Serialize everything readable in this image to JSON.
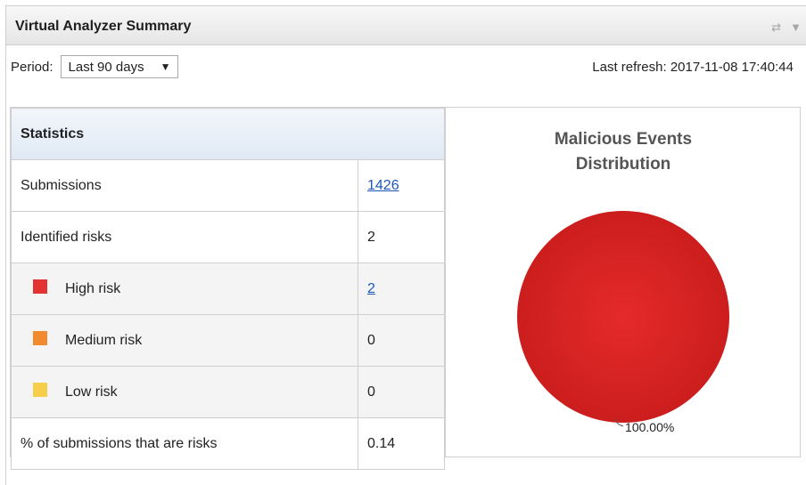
{
  "widget": {
    "title": "Virtual Analyzer Summary",
    "icons": [
      "refresh-icon",
      "dropdown-icon"
    ]
  },
  "period": {
    "label": "Period:",
    "selected": "Last 90 days",
    "arrow": "▼"
  },
  "last_refresh": "Last refresh: 2017-11-08 17:40:44",
  "statistics": {
    "header": "Statistics",
    "rows": [
      {
        "label": "Submissions",
        "value": "1426",
        "link": true
      },
      {
        "label": "Identified risks",
        "value": "2",
        "link": false
      },
      {
        "label": "High risk",
        "value": "2",
        "link": true,
        "color": "#e23232"
      },
      {
        "label": "Medium risk",
        "value": "0",
        "link": false,
        "color": "#f28a30"
      },
      {
        "label": "Low risk",
        "value": "0",
        "link": false,
        "color": "#f7ce4a"
      },
      {
        "label": "% of submissions that are risks",
        "value": "0.14",
        "link": false
      }
    ]
  },
  "chart_data": {
    "type": "pie",
    "title_line1": "Malicious Events",
    "title_line2": "Distribution",
    "slices": [
      {
        "label": "100.00%",
        "value": 100,
        "color": "#d42222"
      }
    ]
  }
}
